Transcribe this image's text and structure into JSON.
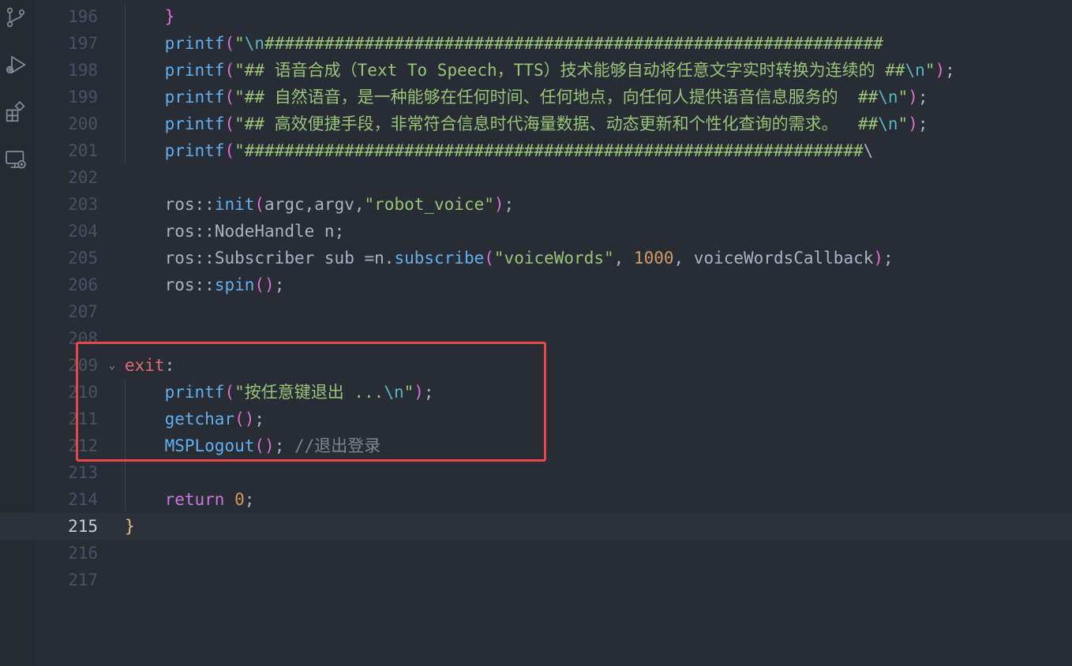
{
  "activity_bar": {
    "icons": [
      "source-control-icon",
      "run-debug-icon",
      "extensions-icon",
      "remote-explorer-icon"
    ]
  },
  "editor": {
    "lines": [
      {
        "n": "196",
        "t": "    }"
      },
      {
        "n": "197",
        "t": "    printf(\"\\n##############################################################"
      },
      {
        "n": "198",
        "t": "    printf(\"## 语音合成（Text To Speech，TTS）技术能够自动将任意文字实时转换为连续的 ##\\n\");"
      },
      {
        "n": "199",
        "t": "    printf(\"## 自然语音，是一种能够在任何时间、任何地点，向任何人提供语音信息服务的  ##\\n\");"
      },
      {
        "n": "200",
        "t": "    printf(\"## 高效便捷手段，非常符合信息时代海量数据、动态更新和个性化查询的需求。  ##\\n\");"
      },
      {
        "n": "201",
        "t": "    printf(\"##############################################################\\"
      },
      {
        "n": "202",
        "t": ""
      },
      {
        "n": "203",
        "t": "    ros::init(argc,argv,\"robot_voice\");"
      },
      {
        "n": "204",
        "t": "    ros::NodeHandle n;"
      },
      {
        "n": "205",
        "t": "    ros::Subscriber sub =n.subscribe(\"voiceWords\", 1000, voiceWordsCallback);"
      },
      {
        "n": "206",
        "t": "    ros::spin();"
      },
      {
        "n": "207",
        "t": ""
      },
      {
        "n": "208",
        "t": ""
      },
      {
        "n": "209",
        "t": "exit:"
      },
      {
        "n": "210",
        "t": "    printf(\"按任意键退出 ...\\n\");"
      },
      {
        "n": "211",
        "t": "    getchar();"
      },
      {
        "n": "212",
        "t": "    MSPLogout(); //退出登录"
      },
      {
        "n": "213",
        "t": ""
      },
      {
        "n": "214",
        "t": "    return 0;"
      },
      {
        "n": "215",
        "t": "}"
      },
      {
        "n": "216",
        "t": ""
      },
      {
        "n": "217",
        "t": ""
      }
    ],
    "current_line": "215",
    "folded_marker_line": "209"
  },
  "colors": {
    "background": "#282c34",
    "highlight_box": "#e8474a",
    "function": "#61afef",
    "string": "#98c379",
    "keyword": "#c678dd",
    "label": "#e06c75",
    "number": "#d19a66"
  }
}
